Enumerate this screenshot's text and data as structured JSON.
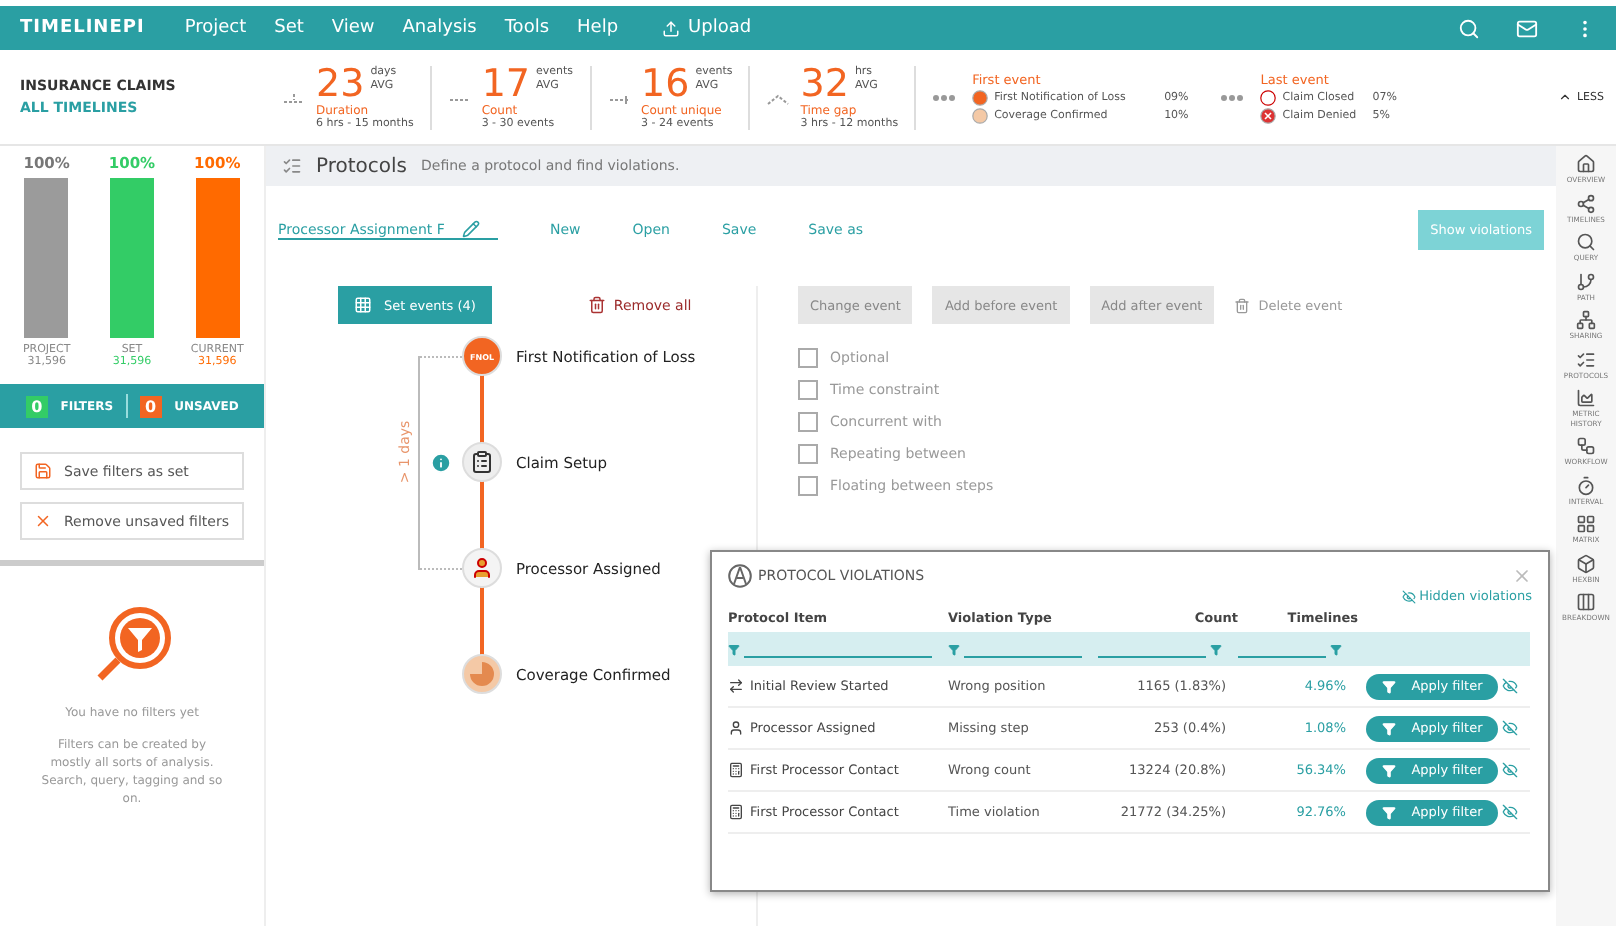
{
  "app": {
    "logo": "TIMELINEPI",
    "menu": [
      "Project",
      "Set",
      "View",
      "Analysis",
      "Tools",
      "Help"
    ],
    "upload": "Upload"
  },
  "dataset": {
    "title": "INSURANCE CLAIMS",
    "subtitle": "ALL TIMELINES"
  },
  "stats": [
    {
      "kind": "duration",
      "value": "23",
      "unit": "days",
      "avg": "AVG",
      "label": "Duration",
      "range": "6 hrs - 15 months"
    },
    {
      "kind": "count",
      "value": "17",
      "unit": "events",
      "avg": "AVG",
      "label": "Count",
      "range": "3 - 30 events"
    },
    {
      "kind": "unique",
      "value": "16",
      "unit": "events",
      "avg": "AVG",
      "label": "Count unique",
      "range": "3 - 24 events"
    },
    {
      "kind": "gap",
      "value": "32",
      "unit": "hrs",
      "avg": "AVG",
      "label": "Time gap",
      "range": "3 hrs - 12 months"
    }
  ],
  "event_summaries": [
    {
      "title": "First event",
      "items": [
        {
          "kind": "fnol",
          "name": "First Notification of Loss",
          "pct": "09%"
        },
        {
          "kind": "pie",
          "name": "Coverage Confirmed",
          "pct": "10%"
        }
      ]
    },
    {
      "title": "Last event",
      "items": [
        {
          "kind": "closed",
          "name": "Claim Closed",
          "pct": "07%"
        },
        {
          "kind": "denied",
          "name": "Claim Denied",
          "pct": "5%"
        }
      ]
    }
  ],
  "less": "LESS",
  "bars": [
    {
      "pct": "100%",
      "level": 1,
      "label": "PROJECT",
      "count": "31,596",
      "color": "#9b9b9b"
    },
    {
      "pct": "100%",
      "level": 1,
      "label": "SET",
      "count": "31,596",
      "color": "#33cc66"
    },
    {
      "pct": "100%",
      "level": 1,
      "label": "CURRENT",
      "count": "31,596",
      "color": "#ff6a00"
    }
  ],
  "filter_summary": {
    "filters_count": "0",
    "filters_label": "FILTERS",
    "unsaved_count": "0",
    "unsaved_label": "UNSAVED"
  },
  "filter_actions": [
    {
      "kind": "save",
      "label": "Save filters as set"
    },
    {
      "kind": "remove",
      "label": "Remove unsaved filters"
    }
  ],
  "empty_state": {
    "title": "You have no filters yet",
    "text": "Filters can be created by mostly all sorts of analysis. Search, query, tagging and so on."
  },
  "protocols": {
    "title": "Protocols",
    "description": "Define a protocol and find violations."
  },
  "toolbar": {
    "name_value": "Processor Assignment F",
    "actions": [
      "New",
      "Open",
      "Save",
      "Save as"
    ],
    "show_button": "Show violations"
  },
  "set_events": "Set events (4)",
  "remove_all": "Remove all",
  "timeline": {
    "constraint": "> 1 days",
    "events": [
      {
        "kind": "fnol",
        "badge": "FNOL",
        "name": "First Notification of Loss",
        "info": false
      },
      {
        "kind": "clipboard",
        "name": "Claim Setup",
        "info": true
      },
      {
        "kind": "person",
        "name": "Processor Assigned",
        "info": false
      },
      {
        "kind": "pie",
        "name": "Coverage Confirmed",
        "info": false
      }
    ]
  },
  "event_actions": [
    {
      "kind": "button",
      "label": "Change event",
      "disabled": true
    },
    {
      "kind": "button",
      "label": "Add before event",
      "disabled": true
    },
    {
      "kind": "button",
      "label": "Add after event",
      "disabled": true
    },
    {
      "kind": "delete",
      "label": "Delete event",
      "disabled": true
    }
  ],
  "options": [
    {
      "label": "Optional",
      "checked": false
    },
    {
      "label": "Time constraint",
      "checked": false
    },
    {
      "label": "Concurrent with",
      "checked": false
    },
    {
      "label": "Repeating between",
      "checked": false
    },
    {
      "label": "Floating between steps",
      "checked": false
    }
  ],
  "violations": {
    "title": "PROTOCOL VIOLATIONS",
    "hidden_link": "Hidden violations",
    "columns": [
      "Protocol Item",
      "Violation Type",
      "Count",
      "Timelines"
    ],
    "rows": [
      {
        "kind": "arrow",
        "item": "Initial Review Started",
        "type": "Wrong position",
        "count": "1165 (1.83%)",
        "timelines": "4.96%",
        "action": "Apply filter"
      },
      {
        "kind": "person",
        "item": "Processor Assigned",
        "type": "Missing step",
        "count": "253 (0.4%)",
        "timelines": "1.08%",
        "action": "Apply filter"
      },
      {
        "kind": "counter",
        "item": "First Processor Contact",
        "type": "Wrong count",
        "count": "13224 (20.8%)",
        "timelines": "56.34%",
        "action": "Apply filter"
      },
      {
        "kind": "counter",
        "item": "First Processor Contact",
        "type": "Time violation",
        "count": "21772 (34.25%)",
        "timelines": "92.76%",
        "action": "Apply filter"
      }
    ]
  },
  "sidebar": [
    {
      "kind": "home",
      "label": "OVERVIEW"
    },
    {
      "kind": "timelines",
      "label": "TIMELINES"
    },
    {
      "kind": "query",
      "label": "QUERY"
    },
    {
      "kind": "path",
      "label": "PATH"
    },
    {
      "kind": "tree",
      "label": "SHARING"
    },
    {
      "kind": "list",
      "label": "PROTOCOLS"
    },
    {
      "kind": "chart",
      "label": "METRIC HISTORY"
    },
    {
      "kind": "flow",
      "label": "WORKFLOW"
    },
    {
      "kind": "timer",
      "label": "INTERVAL"
    },
    {
      "kind": "grid",
      "label": "MATRIX"
    },
    {
      "kind": "box",
      "label": "HEXBIN"
    },
    {
      "kind": "columns",
      "label": "BREAKDOWN"
    }
  ]
}
